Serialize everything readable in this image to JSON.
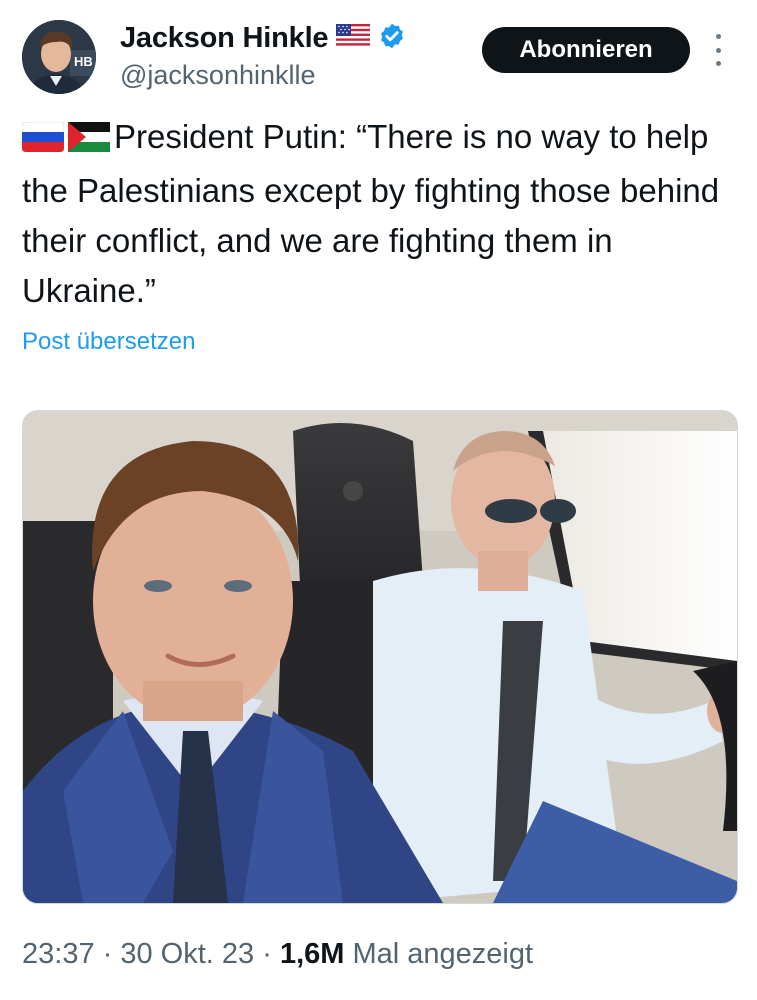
{
  "author": {
    "display_name": "Jackson Hinkle",
    "handle": "@jacksonhinklle",
    "flag_icon": "us-flag-icon",
    "verified_icon": "verified-badge-icon",
    "verified_color": "#1d9bf0",
    "avatar_monogram": "HB"
  },
  "header": {
    "follow_label": "Abonnieren",
    "more_icon": "more-options-icon"
  },
  "tweet": {
    "flags": [
      "russia-flag-icon",
      "palestine-flag-icon"
    ],
    "text": "President Putin: “There is no way to help the Palestinians except by fighting those behind their conflict, and we are fighting them in Ukraine.”",
    "translate_label": "Post übersetzen"
  },
  "meta": {
    "time": "23:37",
    "separator": " · ",
    "date": "30 Okt. 23",
    "views_count": "1,6M",
    "views_label": " Mal angezeigt"
  },
  "colors": {
    "text": "#0f1419",
    "secondary": "#536471",
    "link": "#1d9bf0",
    "button_bg": "#0f1419"
  }
}
